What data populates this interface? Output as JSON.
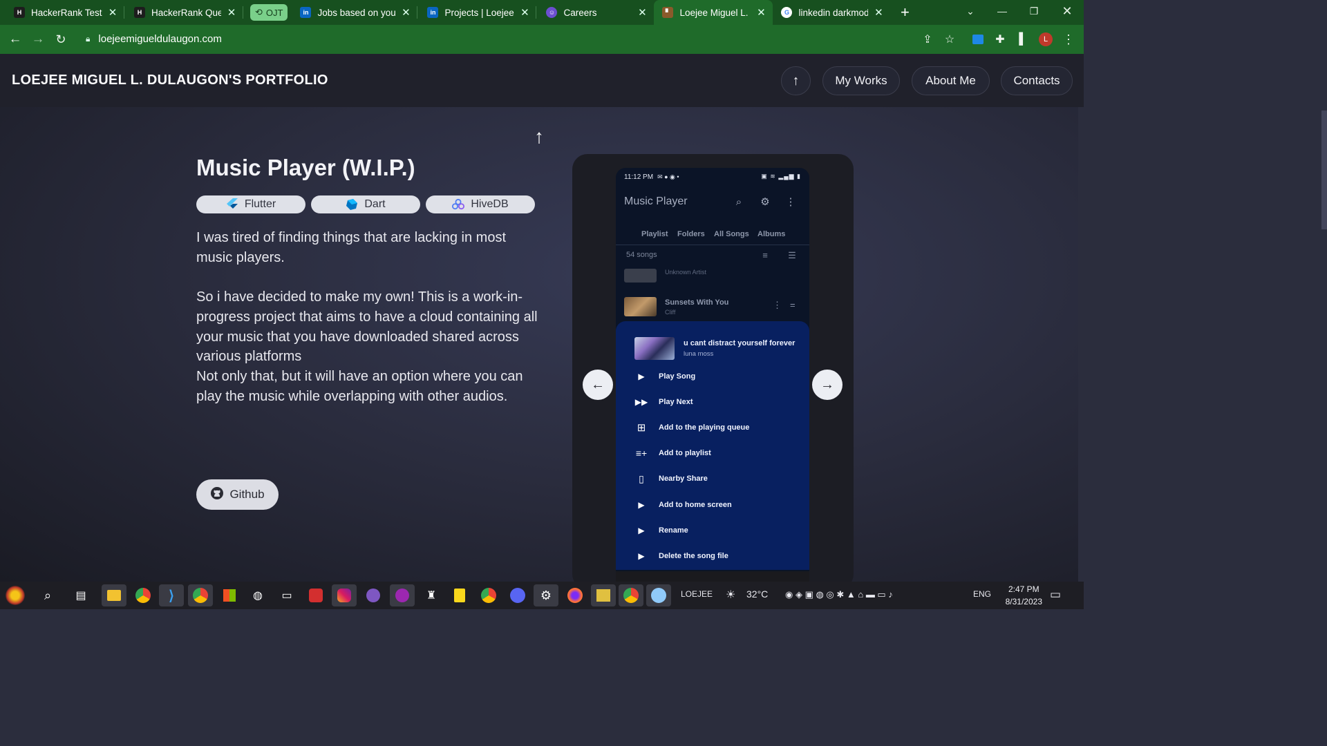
{
  "browser": {
    "tabs": [
      {
        "title": "HackerRank Test Ins",
        "icon": "hackerrank-icon"
      },
      {
        "title": "HackerRank Questic",
        "icon": "hackerrank-icon"
      },
      {
        "title": "Jobs based on your",
        "icon": "linkedin-icon"
      },
      {
        "title": "Projects | Loejee Mi",
        "icon": "linkedin-icon"
      },
      {
        "title": "Careers",
        "icon": "careers-icon"
      },
      {
        "title": "Loejee Miguel L. Du",
        "icon": "portfolio-icon",
        "active": true
      },
      {
        "title": "linkedin darkmode",
        "icon": "google-icon"
      }
    ],
    "tab_group_label": "OJT",
    "url": "loejeemigueldulaugon.com",
    "profile_initial": "L",
    "colors": {
      "frame": "#17501f",
      "toolbar": "#1f6b2a",
      "tab_group": "#7ad08a"
    }
  },
  "site": {
    "title": "LOEJEE MIGUEL L. DULAUGON'S PORTFOLIO",
    "nav": [
      "My Works",
      "About Me",
      "Contacts"
    ],
    "up_icon": "arrow-up-icon"
  },
  "project": {
    "title": "Music Player (W.I.P.)",
    "tech": [
      {
        "label": "Flutter",
        "icon": "flutter-icon"
      },
      {
        "label": "Dart",
        "icon": "dart-icon"
      },
      {
        "label": "HiveDB",
        "icon": "hivedb-icon"
      }
    ],
    "desc_p1": "I was tired of finding things that are lacking in most music players.",
    "desc_p2": "So i have decided to make my own! This is a work-in-progress project that aims to have a cloud containing all your music that you have downloaded shared across various platforms",
    "desc_p3": "Not only that, but it will have an option where you can play the music while overlapping with other audios.",
    "github_label": "Github"
  },
  "phone": {
    "status_time": "11:12 PM",
    "app_title": "Music Player",
    "tabs": [
      "Playlist",
      "Folders",
      "All Songs",
      "Albums"
    ],
    "song_count": "54 songs",
    "songs": [
      {
        "title": "",
        "artist": "Unknown Artist"
      },
      {
        "title": "Sunsets With You",
        "artist": "Cliff"
      }
    ],
    "sheet": {
      "song": "u cant distract yourself forever",
      "artist": "luna moss",
      "options": [
        {
          "label": "Play Song",
          "icon": "play-icon"
        },
        {
          "label": "Play Next",
          "icon": "play-next-icon"
        },
        {
          "label": "Add to the playing queue",
          "icon": "queue-add-icon"
        },
        {
          "label": "Add to playlist",
          "icon": "playlist-add-icon"
        },
        {
          "label": "Nearby Share",
          "icon": "nearby-share-icon"
        },
        {
          "label": "Add to home screen",
          "icon": "play-icon"
        },
        {
          "label": "Rename",
          "icon": "play-icon"
        },
        {
          "label": "Delete the song file",
          "icon": "play-icon"
        }
      ]
    }
  },
  "taskbar": {
    "user_label": "LOEJEE",
    "weather": "32°C",
    "language": "ENG",
    "time": "2:47 PM",
    "date": "8/31/2023"
  }
}
